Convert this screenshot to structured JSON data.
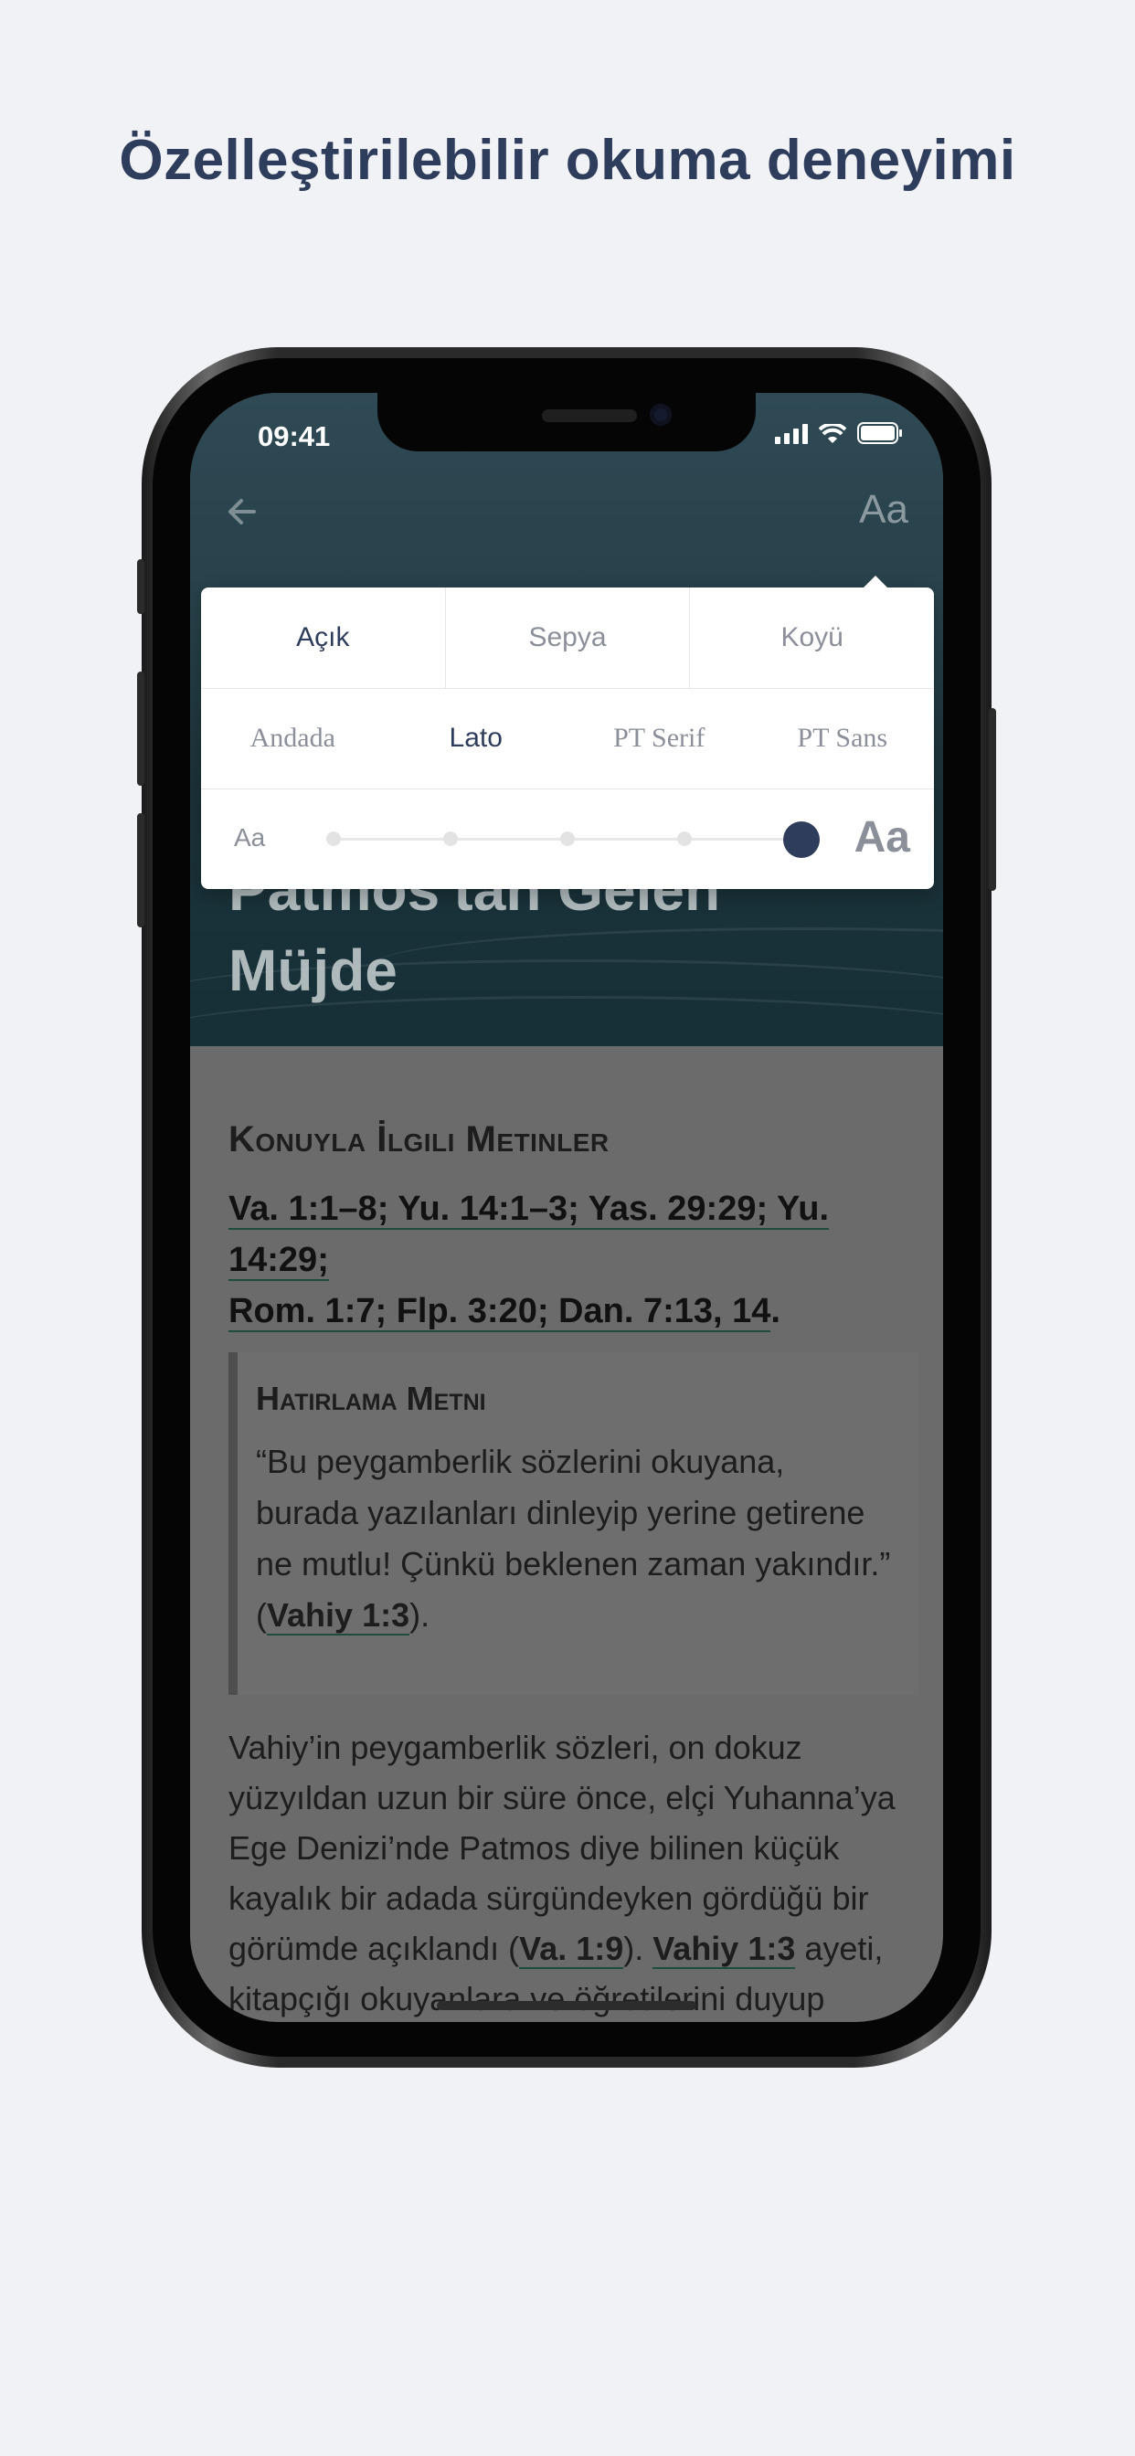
{
  "headline": "Özelleştirilebilir okuma deneyimi",
  "status_bar": {
    "time": "09:41",
    "icons": [
      "signal-icon",
      "wifi-icon",
      "battery-icon"
    ]
  },
  "nav": {
    "back_icon": "arrow-left-icon",
    "text_settings_label": "Aa"
  },
  "settings_popover": {
    "themes": [
      {
        "label": "Açık",
        "active": true
      },
      {
        "label": "Sepya",
        "active": false
      },
      {
        "label": "Koyü",
        "active": false
      }
    ],
    "fonts": [
      {
        "label": "Andada",
        "active": false
      },
      {
        "label": "Lato",
        "active": true
      },
      {
        "label": "PT Serif",
        "active": false
      },
      {
        "label": "PT Sans",
        "active": false
      }
    ],
    "size": {
      "small_label": "Aa",
      "large_label": "Aa",
      "steps": 5,
      "selected_step": 5
    }
  },
  "hero": {
    "title_line1": "Patmos'tan Gelen",
    "title_line2": "Müjde"
  },
  "article": {
    "related_heading": "Konuyla İlgili Metinler",
    "refs_line1": "Va. 1:1–8; Yu. 14:1–3; Yas. 29:29; Yu. 14:29;",
    "refs_line2": "Rom. 1:7; Flp. 3:20; Dan. 7:13, 14",
    "refs_end": ".",
    "memory_heading": "Hatırlama Metni",
    "memory_text": "“Bu peygamberlik sözlerini okuyana, burada yazılanları dinleyip yerine getirene ne mutlu! Çünkü beklenen zaman yakındır.” (",
    "memory_ref": "Vahiy 1:3",
    "memory_end": ").",
    "body_text_1": "Vahiy’in peygamberlik sözleri, on dokuz yüzyıldan uzun bir süre önce, elçi Yuhanna’ya Ege Denizi’nde Patmos diye bilinen küçük kayalık bir adada sürgündeyken gördüğü bir görümde açıklandı (",
    "body_ref_1": "Va. 1:9",
    "body_text_2": "). ",
    "body_ref_2": "Vahiy 1:3",
    "body_text_3": " ayeti, kitapçığı okuyanlara ve öğretilerini duyup"
  }
}
